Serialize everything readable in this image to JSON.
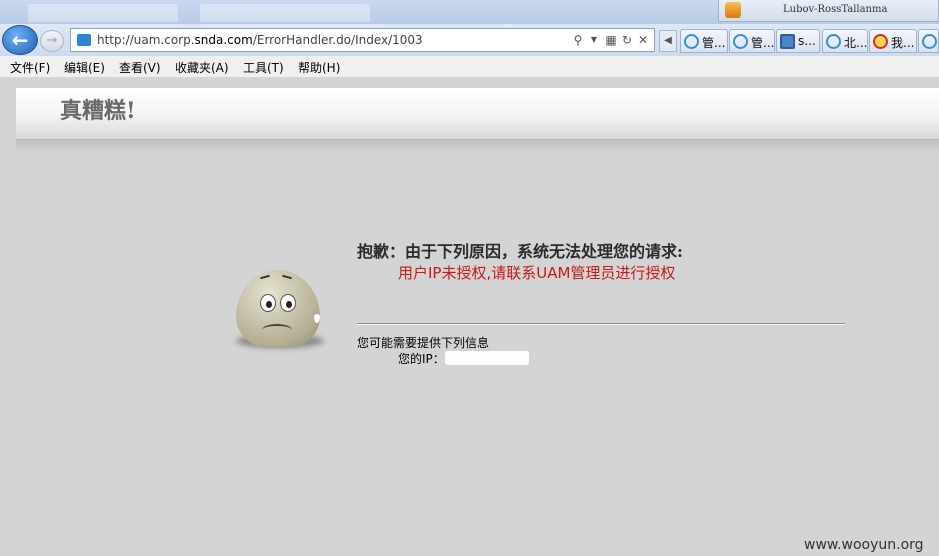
{
  "browser": {
    "user_name": "Lubov-RossTallanma",
    "address": {
      "url_prefix": "http://uam.corp.",
      "url_domain": "snda.com",
      "url_suffix": "/ErrorHandler.do/Index/1003"
    },
    "tabs": [
      {
        "label": "管...",
        "icon": "ie-icon"
      },
      {
        "label": "管...",
        "icon": "ie-icon"
      },
      {
        "label": "s...",
        "icon": "search-icon"
      },
      {
        "label": "北...",
        "icon": "ie-icon"
      },
      {
        "label": "我...",
        "icon": "weibo-icon"
      }
    ]
  },
  "menu": [
    "文件(F)",
    "编辑(E)",
    "查看(V)",
    "收藏夹(A)",
    "工具(T)",
    "帮助(H)"
  ],
  "page": {
    "title": "真糟糕!",
    "error_title": "抱歉：由于下列原因，系统无法处理您的请求:",
    "error_message": "用户IP未授权,请联系UAM管理员进行授权",
    "info_label": "您可能需要提供下列信息",
    "ip_label": "您的IP：",
    "error_color": "#c81818"
  },
  "watermark": "www.wooyun.org"
}
